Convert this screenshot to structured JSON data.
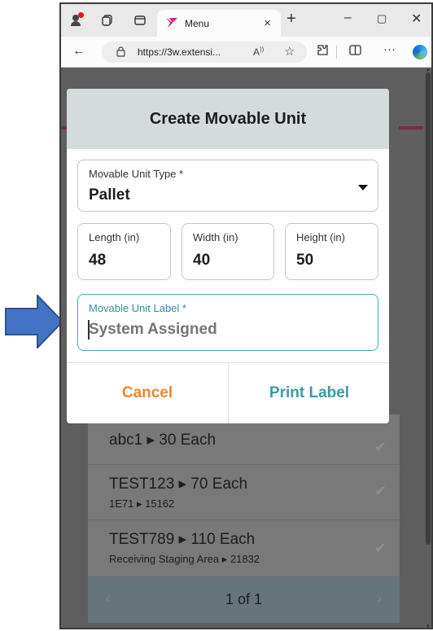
{
  "browser": {
    "tab_title": "Menu",
    "tab_close": "×",
    "new_tab": "+",
    "minimize": "–",
    "maximize": "▢",
    "close": "✕",
    "back": "←",
    "url": "https://3w.extensi...",
    "read_aloud": "Ã̩",
    "favorite": "☆",
    "more": "···"
  },
  "modal": {
    "title": "Create Movable Unit",
    "type_field": {
      "label": "Movable Unit Type *",
      "value": "Pallet"
    },
    "length_field": {
      "label": "Length (in)",
      "value": "48"
    },
    "width_field": {
      "label": "Width (in)",
      "value": "40"
    },
    "height_field": {
      "label": "Height (in)",
      "value": "50"
    },
    "unit_label_field": {
      "label": "Movable Unit Label *",
      "placeholder": "System Assigned"
    },
    "cancel_label": "Cancel",
    "print_label": "Print Label"
  },
  "list": {
    "items": [
      {
        "primary": "abc1 ▸ 30 Each",
        "secondary": ""
      },
      {
        "primary": "TEST123 ▸ 70 Each",
        "secondary": "1E71 ▸ 15162"
      },
      {
        "primary": "TEST789 ▸ 110 Each",
        "secondary": "Receiving Staging Area ▸ 21832"
      }
    ],
    "check_glyph": "✔"
  },
  "pager": {
    "text": "1 of 1",
    "prev": "‹",
    "next": "›"
  },
  "colors": {
    "accent_orange": "#ee8530",
    "accent_teal": "#3a9aa6",
    "arrow_blue": "#4472c4"
  }
}
